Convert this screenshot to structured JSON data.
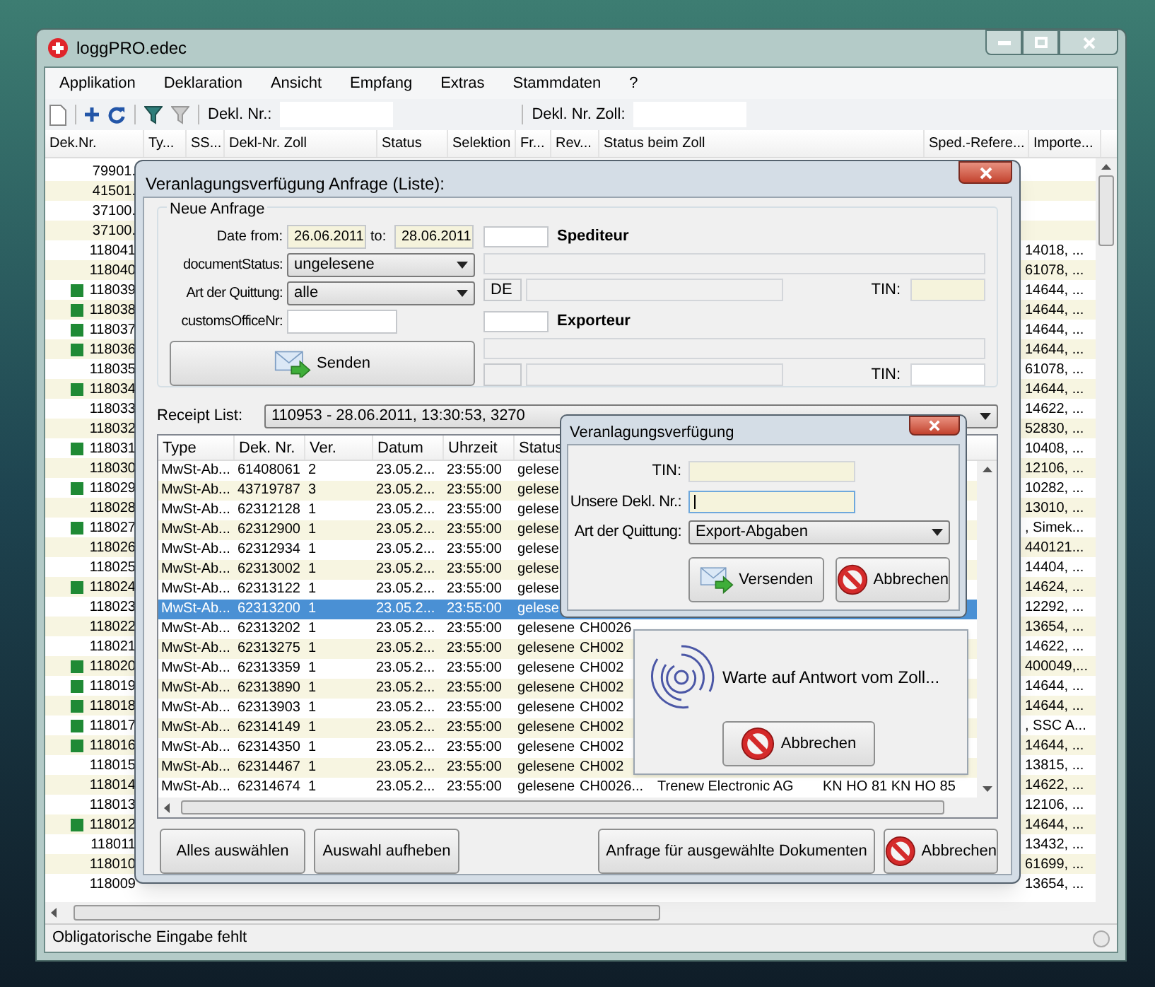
{
  "window": {
    "title": "loggPRO.edec"
  },
  "menu": [
    "Applikation",
    "Deklaration",
    "Ansicht",
    "Empfang",
    "Extras",
    "Stammdaten",
    "?"
  ],
  "toolbar": {
    "fields": [
      {
        "label": "Dekl. Nr.:"
      },
      {
        "label": "Dekl. Nr. Zoll:"
      }
    ]
  },
  "table": {
    "columns": [
      "Dek.Nr.",
      "Ty...",
      "SS...",
      "Dekl-Nr. Zoll",
      "Status",
      "Selektion",
      "Fr...",
      "Rev...",
      "Status beim Zoll",
      "Sped.-Refere...",
      "Importe..."
    ],
    "rows": [
      {
        "dek_nr": "79901.",
        "flag": false
      },
      {
        "dek_nr": "41501.",
        "flag": false
      },
      {
        "dek_nr": "37100.",
        "flag": false
      },
      {
        "dek_nr": "37100.",
        "flag": false
      },
      {
        "dek_nr": "118041",
        "flag": false,
        "importer": "14018, ..."
      },
      {
        "dek_nr": "118040",
        "flag": false,
        "importer": "61078, ..."
      },
      {
        "dek_nr": "118039",
        "flag": true,
        "importer": "14644, ..."
      },
      {
        "dek_nr": "118038",
        "flag": true,
        "importer": "14644, ..."
      },
      {
        "dek_nr": "118037",
        "flag": true,
        "importer": "14644, ..."
      },
      {
        "dek_nr": "118036",
        "flag": true,
        "importer": "14644, ..."
      },
      {
        "dek_nr": "118035",
        "flag": false,
        "importer": "61078, ..."
      },
      {
        "dek_nr": "118034",
        "flag": true,
        "importer": "14644, ..."
      },
      {
        "dek_nr": "118033",
        "flag": false,
        "importer": "14622, ..."
      },
      {
        "dek_nr": "118032",
        "flag": false,
        "importer": "52830, ..."
      },
      {
        "dek_nr": "118031",
        "flag": true,
        "importer": "10408, ..."
      },
      {
        "dek_nr": "118030",
        "flag": false,
        "importer": "12106, ..."
      },
      {
        "dek_nr": "118029",
        "flag": true,
        "importer": "10282, ..."
      },
      {
        "dek_nr": "118028",
        "flag": false,
        "importer": "13010, ..."
      },
      {
        "dek_nr": "118027",
        "flag": true,
        "importer": ", Simek..."
      },
      {
        "dek_nr": "118026",
        "flag": false,
        "importer": "440121..."
      },
      {
        "dek_nr": "118025",
        "flag": false,
        "importer": "14404, ..."
      },
      {
        "dek_nr": "118024",
        "flag": true,
        "importer": "14624, ..."
      },
      {
        "dek_nr": "118023",
        "flag": false,
        "importer": "12292, ..."
      },
      {
        "dek_nr": "118022",
        "flag": false,
        "importer": "13654, ..."
      },
      {
        "dek_nr": "118021",
        "flag": false,
        "importer": "14622, ..."
      },
      {
        "dek_nr": "118020",
        "flag": true,
        "importer": "400049,..."
      },
      {
        "dek_nr": "118019",
        "flag": true,
        "importer": "14644, ..."
      },
      {
        "dek_nr": "118018",
        "flag": true,
        "importer": "14644, ..."
      },
      {
        "dek_nr": "118017",
        "flag": true,
        "importer": ", SSC A..."
      },
      {
        "dek_nr": "118016",
        "flag": true,
        "importer": "14644, ..."
      },
      {
        "dek_nr": "118015",
        "flag": false,
        "importer": "13815, ..."
      },
      {
        "dek_nr": "118014",
        "flag": false,
        "importer": "14622, ..."
      },
      {
        "dek_nr": "118013",
        "flag": false,
        "importer": "12106, ..."
      },
      {
        "dek_nr": "118012",
        "flag": true,
        "importer": "14644, ..."
      },
      {
        "dek_nr": "118011",
        "flag": false,
        "importer": "13432, ..."
      },
      {
        "dek_nr": "118010",
        "flag": false,
        "importer": "61699, ..."
      },
      {
        "dek_nr": "118009",
        "flag": false,
        "importer": "13654, ..."
      }
    ]
  },
  "status_bar": "Obligatorische Eingabe fehlt",
  "dialog": {
    "title": "Veranlagungsverfügung Anfrage (Liste):",
    "group": {
      "title": "Neue Anfrage",
      "date_from": {
        "label": "Date from:",
        "value": "26.06.2011"
      },
      "date_to": {
        "label": "to:",
        "value": "28.06.2011"
      },
      "document_status": {
        "label": "documentStatus:",
        "value": "ungelesene"
      },
      "art_der_quittung": {
        "label": "Art der Quittung:",
        "value": "alle"
      },
      "customs_office_nr": {
        "label": "customsOfficeNr:"
      },
      "send_button": "Senden"
    },
    "spediteur": {
      "label": "Spediteur",
      "country": "DE",
      "tin_label": "TIN:"
    },
    "exporteur": {
      "label": "Exporteur",
      "tin_label": "TIN:"
    },
    "receipt_list": {
      "label": "Receipt List:",
      "value": "110953 - 28.06.2011, 13:30:53, 3270"
    },
    "list": {
      "columns": [
        "Type",
        "Dek. Nr.",
        "Ver.",
        "Datum",
        "Uhrzeit",
        "Status"
      ],
      "rows": [
        {
          "type": "MwSt-Ab...",
          "dek_nr": "61408061",
          "ver": "2",
          "datum": "23.05.2...",
          "uhrzeit": "23:55:00",
          "status": "gelese",
          "selected": false
        },
        {
          "type": "MwSt-Ab...",
          "dek_nr": "43719787",
          "ver": "3",
          "datum": "23.05.2...",
          "uhrzeit": "23:55:00",
          "status": "gelese",
          "selected": false
        },
        {
          "type": "MwSt-Ab...",
          "dek_nr": "62312128",
          "ver": "1",
          "datum": "23.05.2...",
          "uhrzeit": "23:55:00",
          "status": "gelese",
          "selected": false
        },
        {
          "type": "MwSt-Ab...",
          "dek_nr": "62312900",
          "ver": "1",
          "datum": "23.05.2...",
          "uhrzeit": "23:55:00",
          "status": "gelese",
          "selected": false
        },
        {
          "type": "MwSt-Ab...",
          "dek_nr": "62312934",
          "ver": "1",
          "datum": "23.05.2...",
          "uhrzeit": "23:55:00",
          "status": "gelese",
          "selected": false
        },
        {
          "type": "MwSt-Ab...",
          "dek_nr": "62313002",
          "ver": "1",
          "datum": "23.05.2...",
          "uhrzeit": "23:55:00",
          "status": "gelese",
          "selected": false
        },
        {
          "type": "MwSt-Ab...",
          "dek_nr": "62313122",
          "ver": "1",
          "datum": "23.05.2...",
          "uhrzeit": "23:55:00",
          "status": "gelese",
          "selected": false
        },
        {
          "type": "MwSt-Ab...",
          "dek_nr": "62313200",
          "ver": "1",
          "datum": "23.05.2...",
          "uhrzeit": "23:55:00",
          "status": "gelese",
          "selected": true
        },
        {
          "type": "MwSt-Ab...",
          "dek_nr": "62313202",
          "ver": "1",
          "datum": "23.05.2...",
          "uhrzeit": "23:55:00",
          "status": "gelesene",
          "column_7": "CH0026",
          "selected": false
        },
        {
          "type": "MwSt-Ab...",
          "dek_nr": "62313275",
          "ver": "1",
          "datum": "23.05.2...",
          "uhrzeit": "23:55:00",
          "status": "gelesene",
          "column_7": "CH002",
          "selected": false
        },
        {
          "type": "MwSt-Ab...",
          "dek_nr": "62313359",
          "ver": "1",
          "datum": "23.05.2...",
          "uhrzeit": "23:55:00",
          "status": "gelesene",
          "column_7": "CH002",
          "selected": false
        },
        {
          "type": "MwSt-Ab...",
          "dek_nr": "62313890",
          "ver": "1",
          "datum": "23.05.2...",
          "uhrzeit": "23:55:00",
          "status": "gelesene",
          "column_7": "CH002",
          "selected": false
        },
        {
          "type": "MwSt-Ab...",
          "dek_nr": "62313903",
          "ver": "1",
          "datum": "23.05.2...",
          "uhrzeit": "23:55:00",
          "status": "gelesene",
          "column_7": "CH002",
          "selected": false
        },
        {
          "type": "MwSt-Ab...",
          "dek_nr": "62314149",
          "ver": "1",
          "datum": "23.05.2...",
          "uhrzeit": "23:55:00",
          "status": "gelesene",
          "column_7": "CH002",
          "selected": false
        },
        {
          "type": "MwSt-Ab...",
          "dek_nr": "62314350",
          "ver": "1",
          "datum": "23.05.2...",
          "uhrzeit": "23:55:00",
          "status": "gelesene",
          "column_7": "CH002",
          "selected": false
        },
        {
          "type": "MwSt-Ab...",
          "dek_nr": "62314467",
          "ver": "1",
          "datum": "23.05.2...",
          "uhrzeit": "23:55:00",
          "status": "gelesene",
          "column_7": "CH002",
          "selected": false
        },
        {
          "type": "MwSt-Ab...",
          "dek_nr": "62314674",
          "ver": "1",
          "datum": "23.05.2...",
          "uhrzeit": "23:55:00",
          "status": "gelesene",
          "column_7": "CH0026...",
          "column_8": "Trenew Electronic AG",
          "column_9": "KN HO 81 KN HO 85",
          "selected": false
        }
      ]
    },
    "buttons": [
      "Alles auswählen",
      "Auswahl aufheben",
      "Anfrage für ausgewählte Dokumenten"
    ],
    "cancel_button": "Abbrechen"
  },
  "sub_dialog": {
    "title": "Veranlagungsverfügung",
    "tin_label": "TIN:",
    "dekl_label": "Unsere Dekl. Nr.:",
    "art_label": "Art der Quittung:",
    "art_value": "Export-Abgaben",
    "send_button": "Versenden",
    "cancel_button": "Abbrechen"
  },
  "wait_panel": {
    "message": "Warte auf Antwort vom Zoll...",
    "cancel_button": "Abbrechen"
  }
}
